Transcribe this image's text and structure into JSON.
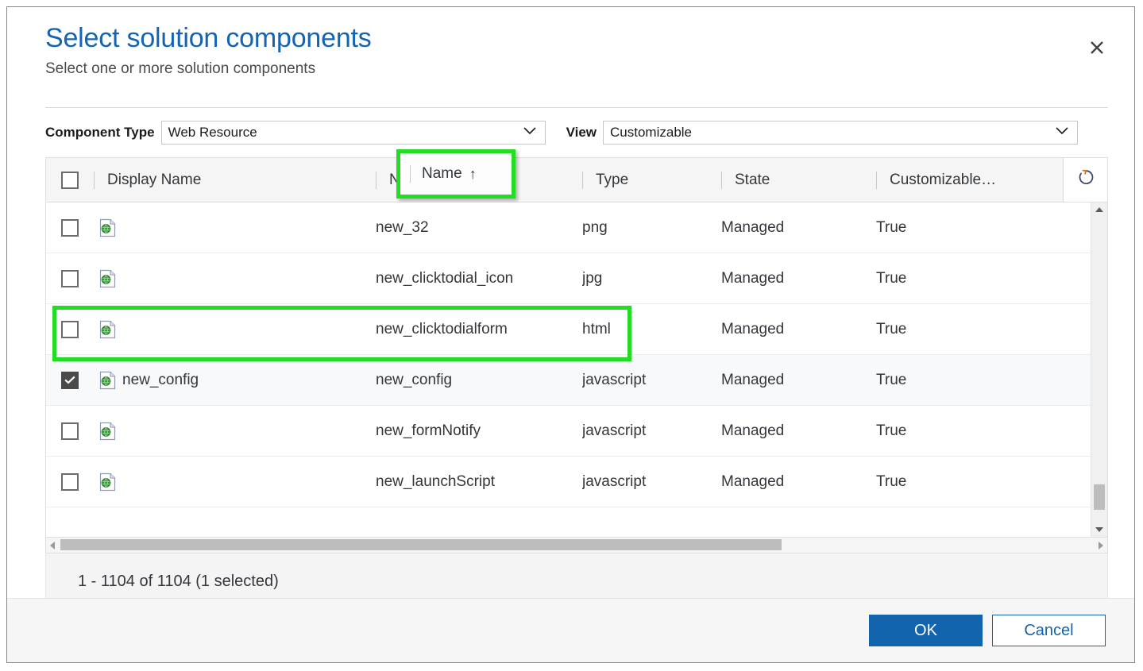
{
  "dialog": {
    "title": "Select solution components",
    "subtitle": "Select one or more solution components",
    "close_label": "✕"
  },
  "filters": {
    "component_type": {
      "label": "Component Type",
      "value": "Web Resource"
    },
    "view": {
      "label": "View",
      "value": "Customizable"
    }
  },
  "grid": {
    "columns": [
      {
        "key": "display_name",
        "label": "Display Name",
        "sorted": false
      },
      {
        "key": "name",
        "label": "Name",
        "sorted": true,
        "sort_arrow": "↑"
      },
      {
        "key": "type",
        "label": "Type",
        "sorted": false
      },
      {
        "key": "state",
        "label": "State",
        "sorted": false
      },
      {
        "key": "customizable",
        "label": "Customizable…",
        "sorted": false
      }
    ],
    "refresh_icon": "refresh-icon",
    "select_all_checked": false,
    "rows": [
      {
        "checked": false,
        "icon": "web-resource-icon",
        "display_name": "",
        "name": "new_32",
        "type": "png",
        "state": "Managed",
        "customizable": "True"
      },
      {
        "checked": false,
        "icon": "web-resource-icon",
        "display_name": "",
        "name": "new_clicktodial_icon",
        "type": "jpg",
        "state": "Managed",
        "customizable": "True"
      },
      {
        "checked": false,
        "icon": "web-resource-icon",
        "display_name": "",
        "name": "new_clicktodialform",
        "type": "html",
        "state": "Managed",
        "customizable": "True"
      },
      {
        "checked": true,
        "icon": "web-resource-icon",
        "display_name": "new_config",
        "name": "new_config",
        "type": "javascript",
        "state": "Managed",
        "customizable": "True"
      },
      {
        "checked": false,
        "icon": "web-resource-icon",
        "display_name": "",
        "name": "new_formNotify",
        "type": "javascript",
        "state": "Managed",
        "customizable": "True"
      },
      {
        "checked": false,
        "icon": "web-resource-icon",
        "display_name": "",
        "name": "new_launchScript",
        "type": "javascript",
        "state": "Managed",
        "customizable": "True"
      }
    ]
  },
  "status": {
    "text": "1 - 1104 of 1104 (1 selected)"
  },
  "footer": {
    "ok_label": "OK",
    "cancel_label": "Cancel"
  },
  "annotations": {
    "highlight_color": "#22dd22",
    "name_header_box": "Name column header highlighted",
    "selected_row_box": "new_config row highlighted"
  },
  "colors": {
    "title_blue": "#1464b4",
    "primary_button": "#1264ad",
    "highlight_green": "#22dd22"
  }
}
